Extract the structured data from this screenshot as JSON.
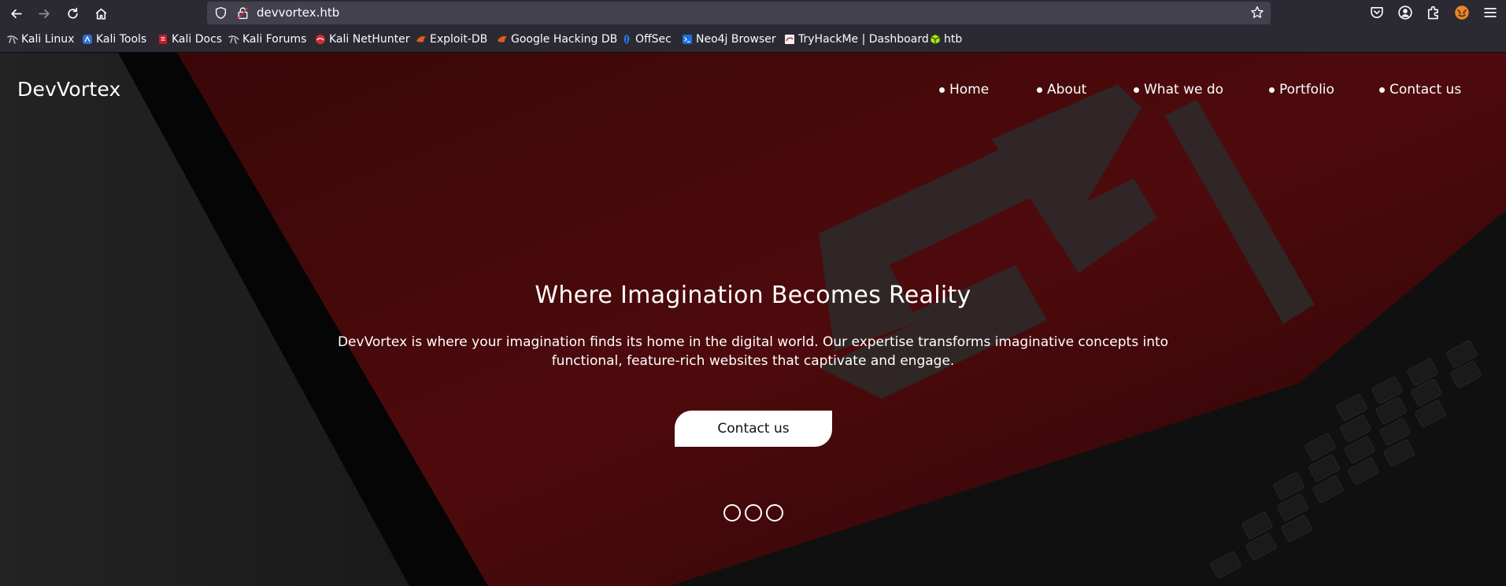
{
  "browser": {
    "url": "devvortex.htb",
    "icons": {
      "back": "arrow-left-icon",
      "forward": "arrow-right-icon",
      "reload": "reload-icon",
      "home": "home-icon",
      "shield": "shield-icon",
      "lock": "lock-icon",
      "bookmark_star": "star-icon",
      "pocket": "pocket-icon",
      "account": "account-icon",
      "extensions": "puzzle-icon",
      "profile": "fox-icon",
      "menu": "hamburger-icon"
    },
    "bookmarks": [
      {
        "label": "Kali Linux",
        "icon": "kali-icon"
      },
      {
        "label": "Kali Tools",
        "icon": "kali-tools-icon"
      },
      {
        "label": "Kali Docs",
        "icon": "kali-docs-icon"
      },
      {
        "label": "Kali Forums",
        "icon": "kali-icon"
      },
      {
        "label": "Kali NetHunter",
        "icon": "nethunter-icon"
      },
      {
        "label": "Exploit-DB",
        "icon": "exploitdb-icon"
      },
      {
        "label": "Google Hacking DB",
        "icon": "exploitdb-icon"
      },
      {
        "label": "OffSec",
        "icon": "offsec-icon"
      },
      {
        "label": "Neo4j Browser",
        "icon": "terminal-icon"
      },
      {
        "label": "TryHackMe | Dashboard",
        "icon": "tryhackme-icon"
      },
      {
        "label": "htb",
        "icon": "cube-icon"
      }
    ]
  },
  "site": {
    "brand": "DevVortex",
    "nav": [
      {
        "label": "Home"
      },
      {
        "label": "About"
      },
      {
        "label": "What we do"
      },
      {
        "label": "Portfolio"
      },
      {
        "label": "Contact us"
      }
    ],
    "hero": {
      "title": "Where Imagination Becomes Reality",
      "text": "DevVortex is where your imagination finds its home in the digital world. Our expertise transforms imaginative concepts into functional, feature-rich websites that captivate and engage.",
      "button": "Contact us",
      "slides": 3
    }
  },
  "colors": {
    "chrome": "#2b2a33",
    "urlbar": "#42414d",
    "page_dark": "#141414",
    "accent_red": "#5a0a0c",
    "text": "#ffffff"
  }
}
